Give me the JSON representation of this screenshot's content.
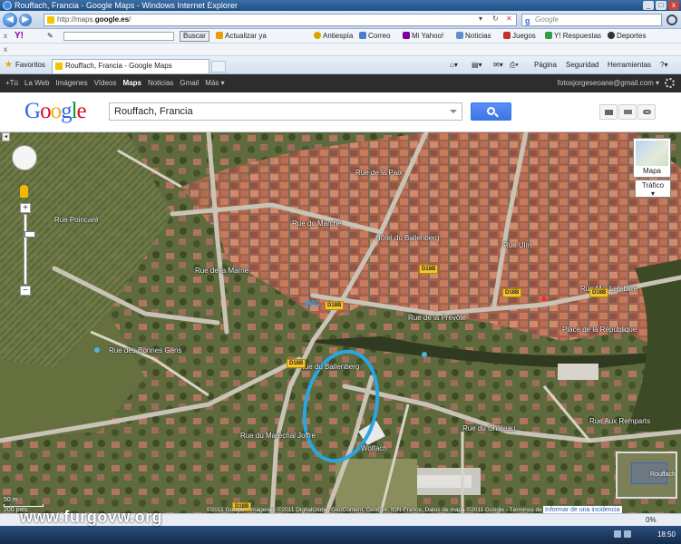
{
  "window": {
    "title": "Rouffach, Francia - Google Maps - Windows Internet Explorer",
    "controls": [
      "_",
      "□",
      "x"
    ]
  },
  "address_bar": {
    "url_prefix": "http://maps.",
    "url_domain": "google.es",
    "url_suffix": "/",
    "search_placeholder": "Google"
  },
  "yahoo_toolbar": {
    "buscar": "Buscar",
    "items": [
      "Actualizar ya",
      "Antiespía",
      "Correo",
      "Mi Yahoo!",
      "Noticias",
      "Juegos",
      "Y! Respuestas",
      "Deportes"
    ]
  },
  "x_row": "x",
  "favorites_bar": {
    "favorites_label": "Favoritos",
    "tab_title": "Rouffach, Francia - Google Maps",
    "commands": [
      "Página",
      "Seguridad",
      "Herramientas"
    ]
  },
  "google_bar": {
    "links": [
      "+Tú",
      "La Web",
      "Imágenes",
      "Vídeos",
      "Maps",
      "Noticias",
      "Gmail",
      "Más"
    ],
    "active": "Maps",
    "account": "fotosjorgeseoane@gmail.com"
  },
  "search": {
    "logo": "Google",
    "query": "Rouffach, Francia"
  },
  "map": {
    "map_type_label": "Mapa",
    "traffic_label": "Tráfico",
    "overview_label": "Rouffach",
    "scale_top": "50 m",
    "scale_bottom": "200 pies",
    "copyright": "©2011 Google - Imágenes ©2011 DigitalGlobe, GeoContent, GeoEye, IGN-France, Datos de mapa ©2011 Google - Términos de uso",
    "report_link": "Informar de una incidencia",
    "street_labels": [
      "Rue de la Paix",
      "Rue du Marché",
      "Hôtel du Ballenberg",
      "Rue Mal Lefebvre",
      "Rue de la Prévôté",
      "Place de la République",
      "Rue des Bonnes Gens",
      "Rue de la Marne",
      "Rue Ulm",
      "Rue du Ballenberg",
      "Rue du Château",
      "Rue Poincaré",
      "Rue du Maréchal Joffre",
      "Rue Aux Remparts",
      "Wolfach"
    ],
    "road_tags": [
      "D18B",
      "D18B",
      "D18B",
      "D18B",
      "D18B",
      "D18B"
    ]
  },
  "watermark": "www.furgovw.org",
  "status_bar": {
    "zoom": "0%"
  },
  "taskbar": {
    "clock": "18:50"
  }
}
